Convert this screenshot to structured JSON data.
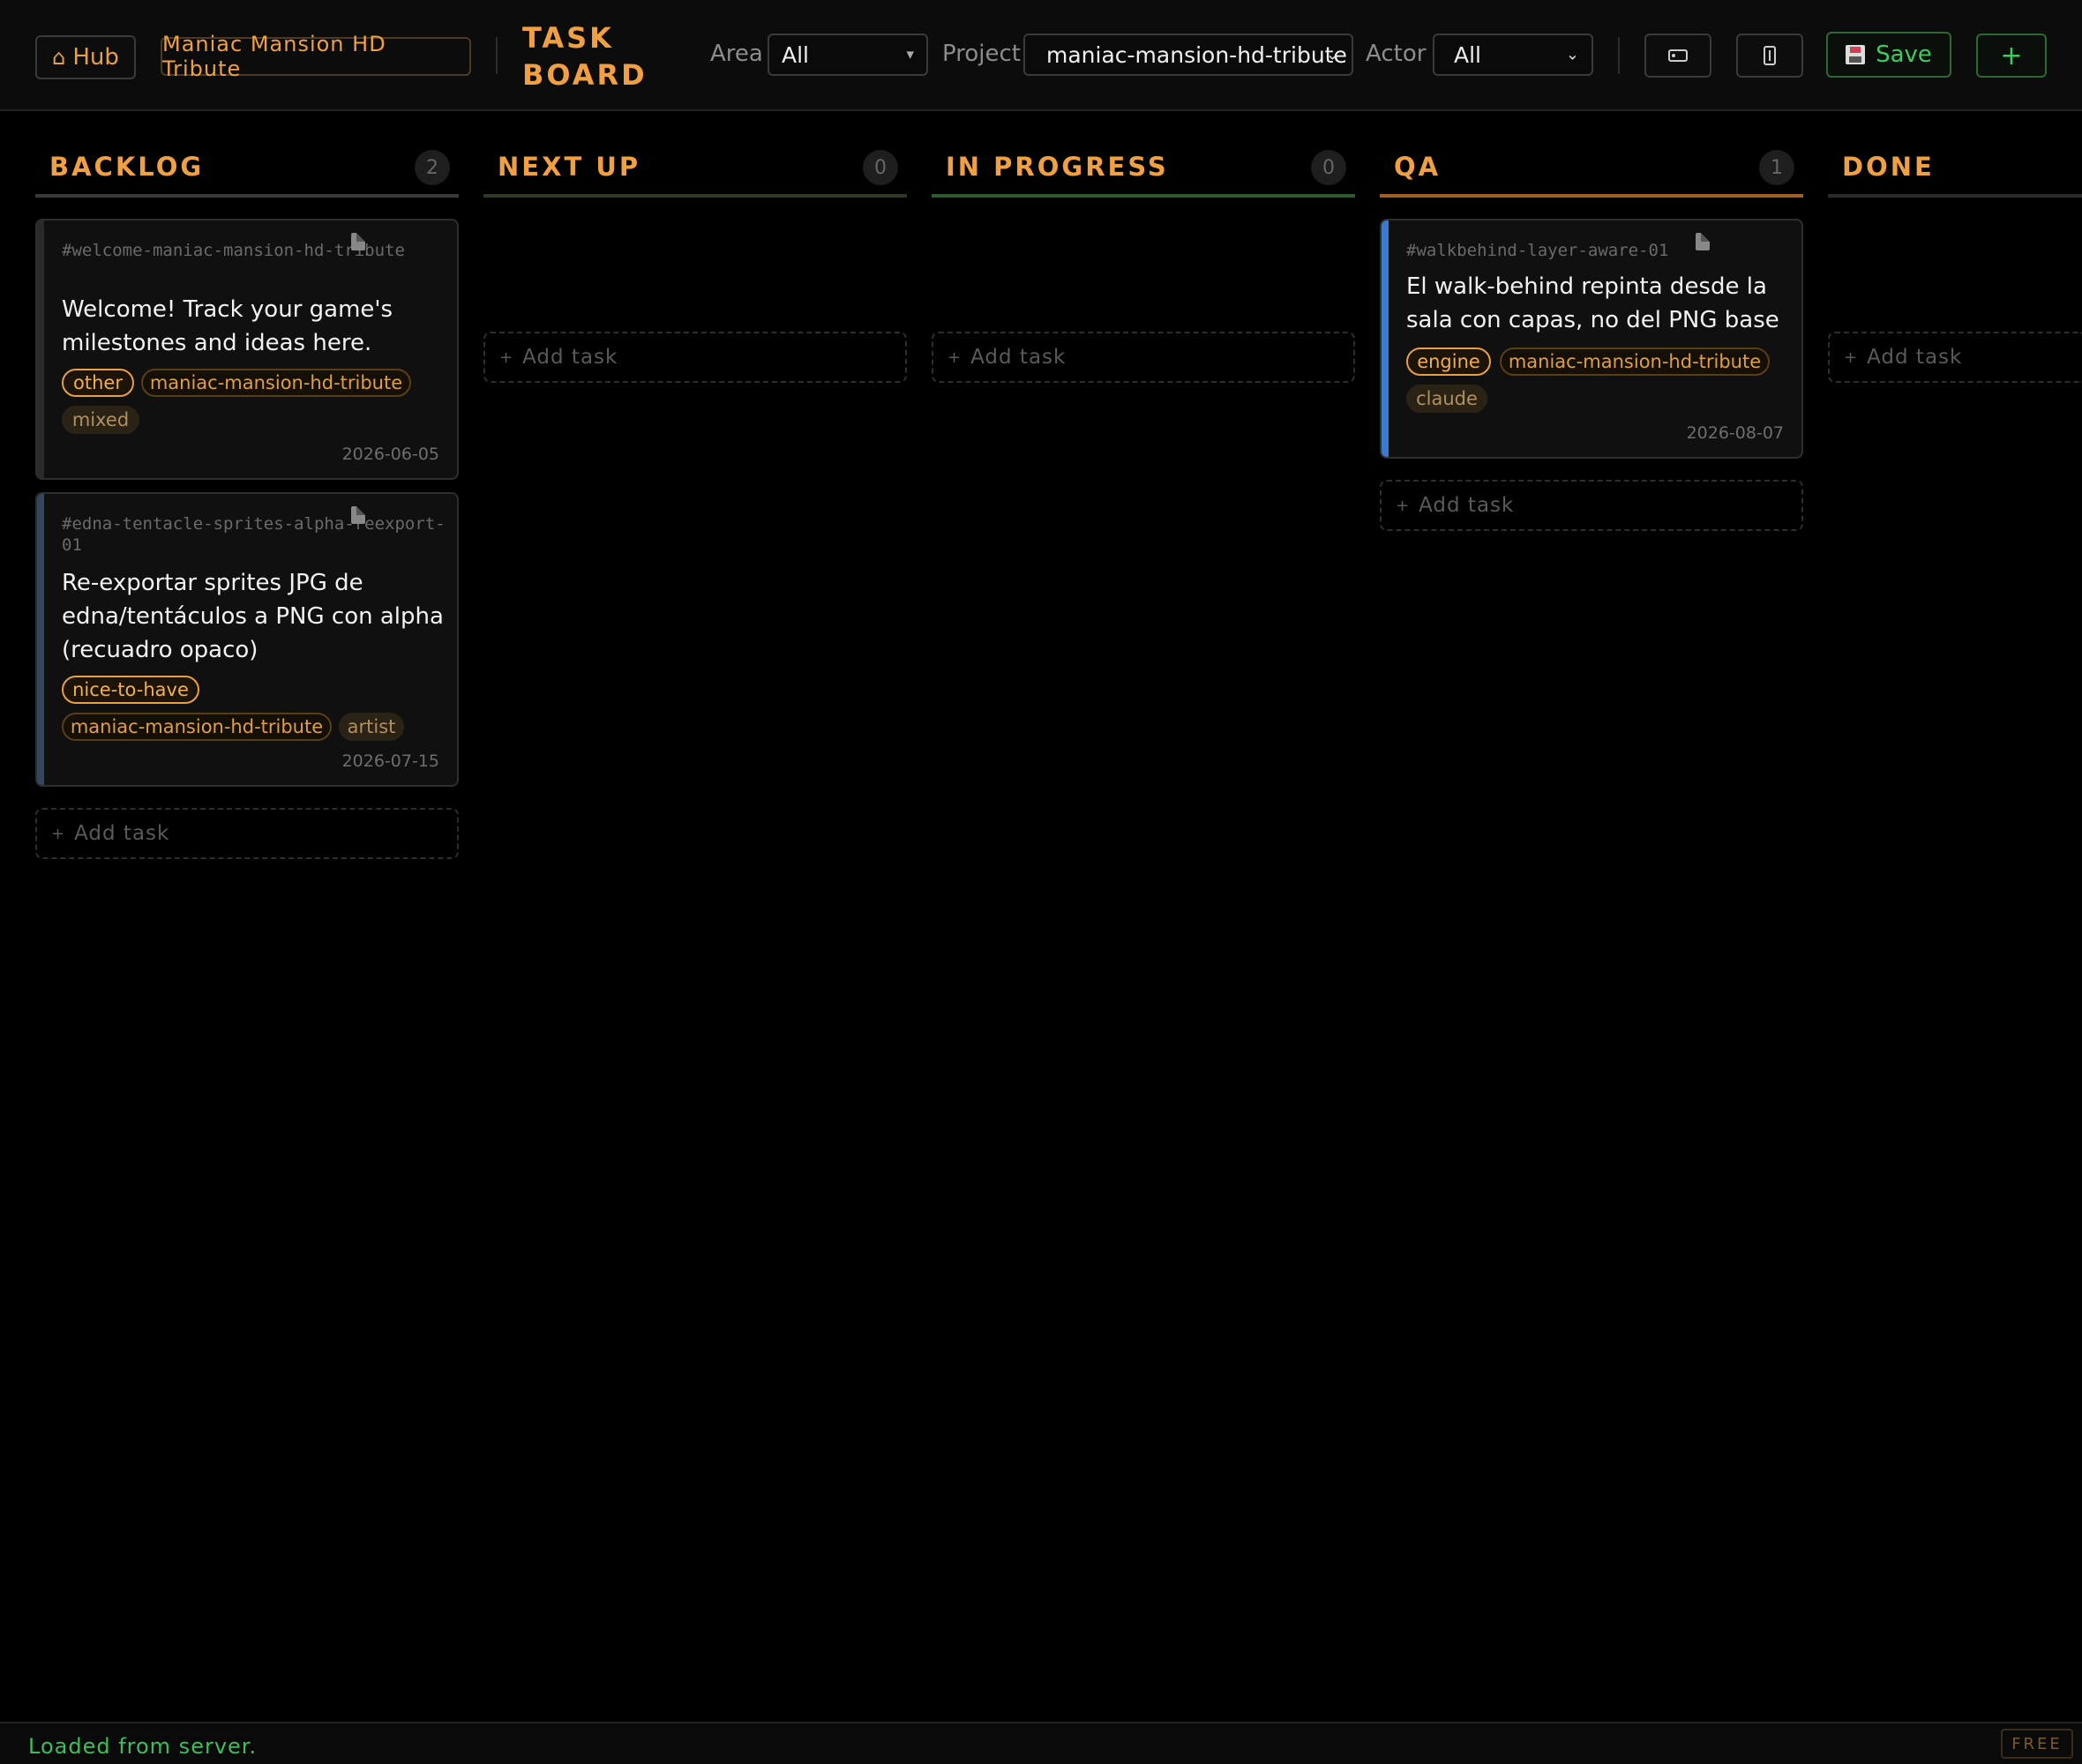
{
  "header": {
    "hub_label": "Hub",
    "project_badge": "Maniac Mansion HD Tribute",
    "board_title": "TASK BOARD",
    "filters": {
      "area_label": "Area",
      "area_value": "All",
      "project_label": "Project",
      "project_value": "maniac-mansion-hd-tribute",
      "actor_label": "Actor",
      "actor_value": "All"
    },
    "save_label": "Save",
    "add_label": "+"
  },
  "columns": [
    {
      "title": "BACKLOG",
      "count": "2",
      "color": "#3a3a3a"
    },
    {
      "title": "NEXT UP",
      "count": "0",
      "color": "#2e3a26"
    },
    {
      "title": "IN PROGRESS",
      "count": "0",
      "color": "#2f5a2f"
    },
    {
      "title": "QA",
      "count": "1",
      "color": "#a06020"
    },
    {
      "title": "DONE",
      "count": "",
      "color": "#2a2a2a"
    }
  ],
  "cards": {
    "backlog": [
      {
        "id": "#welcome-maniac-mansion-hd-tribute",
        "title": "Welcome! Track your game's milestones and ideas here.",
        "tags": [
          "other",
          "maniac-mansion-hd-tribute",
          "mixed"
        ],
        "date": "2026-06-05",
        "stripe": "#2a2a2a"
      },
      {
        "id": "#edna-tentacle-sprites-alpha-reexport-01",
        "title": "Re-exportar sprites JPG de edna/tentáculos a PNG con alpha (recuadro opaco)",
        "tags": [
          "nice-to-have",
          "maniac-mansion-hd-tribute",
          "artist"
        ],
        "date": "2026-07-15",
        "stripe": "#34465e"
      }
    ],
    "qa": [
      {
        "id": "#walkbehind-layer-aware-01",
        "title": "El walk-behind repinta desde la sala con capas, no del PNG base",
        "tags": [
          "engine",
          "maniac-mansion-hd-tribute",
          "claude"
        ],
        "date": "2026-08-07",
        "stripe": "#3a7ad0"
      }
    ]
  },
  "add_task_label": "Add task",
  "status": {
    "message": "Loaded from server.",
    "plan_badge": "FREE"
  }
}
